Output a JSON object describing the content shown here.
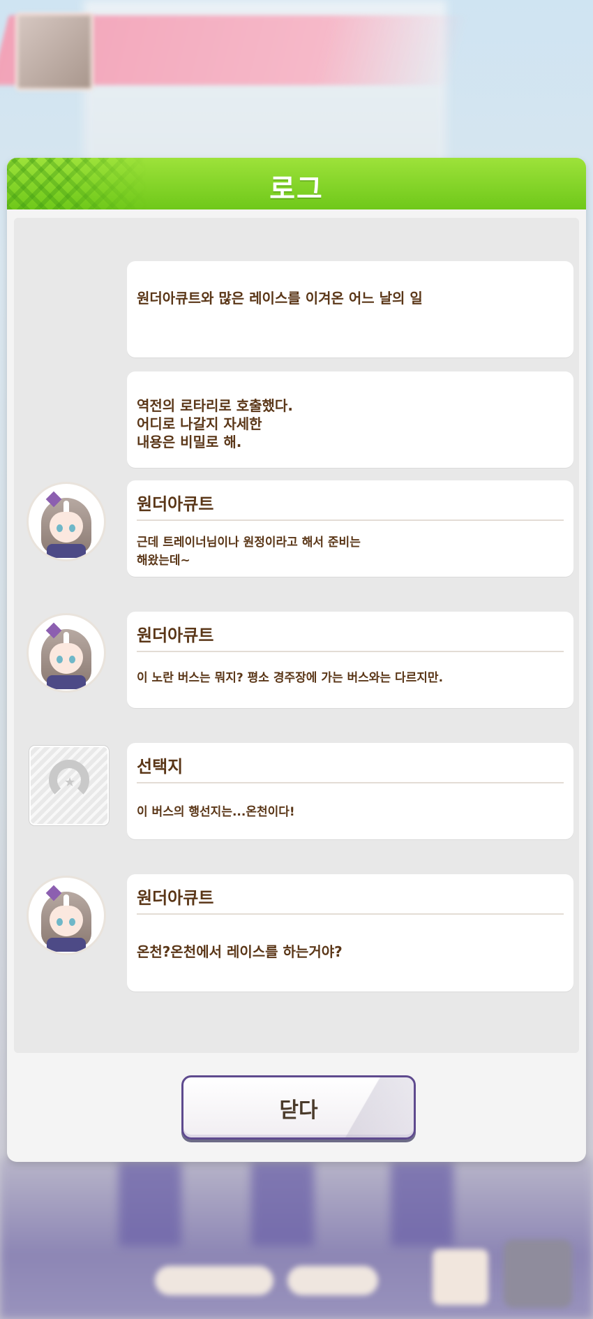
{
  "modal": {
    "title": "로그",
    "close_label": "닫다"
  },
  "log": [
    {
      "type": "narration",
      "text": "원더아큐트와 많은 레이스를 이겨온 어느 날의 일"
    },
    {
      "type": "narration",
      "text": "역전의 로타리로 호출했다.\n어디로 나갈지 자세한\n내용은 비밀로 해."
    },
    {
      "type": "dialogue",
      "speaker": "원더아큐트",
      "text": "근데 트레이너님이나 원정이라고 해서 준비는\n해왔는데~",
      "icon": "wonder-acute-portrait"
    },
    {
      "type": "dialogue",
      "speaker": "원더아큐트",
      "text": "이 노란 버스는 뭐지? 평소 경주장에 가는 버스와는 다르지만.",
      "icon": "wonder-acute-portrait"
    },
    {
      "type": "choice",
      "speaker": "선택지",
      "text": "이 버스의 행선지는...온천이다!",
      "icon": "horseshoe-icon"
    },
    {
      "type": "dialogue",
      "speaker": "원더아큐트",
      "text": "온천?온천에서 레이스를 하는거야?",
      "icon": "wonder-acute-portrait"
    }
  ]
}
